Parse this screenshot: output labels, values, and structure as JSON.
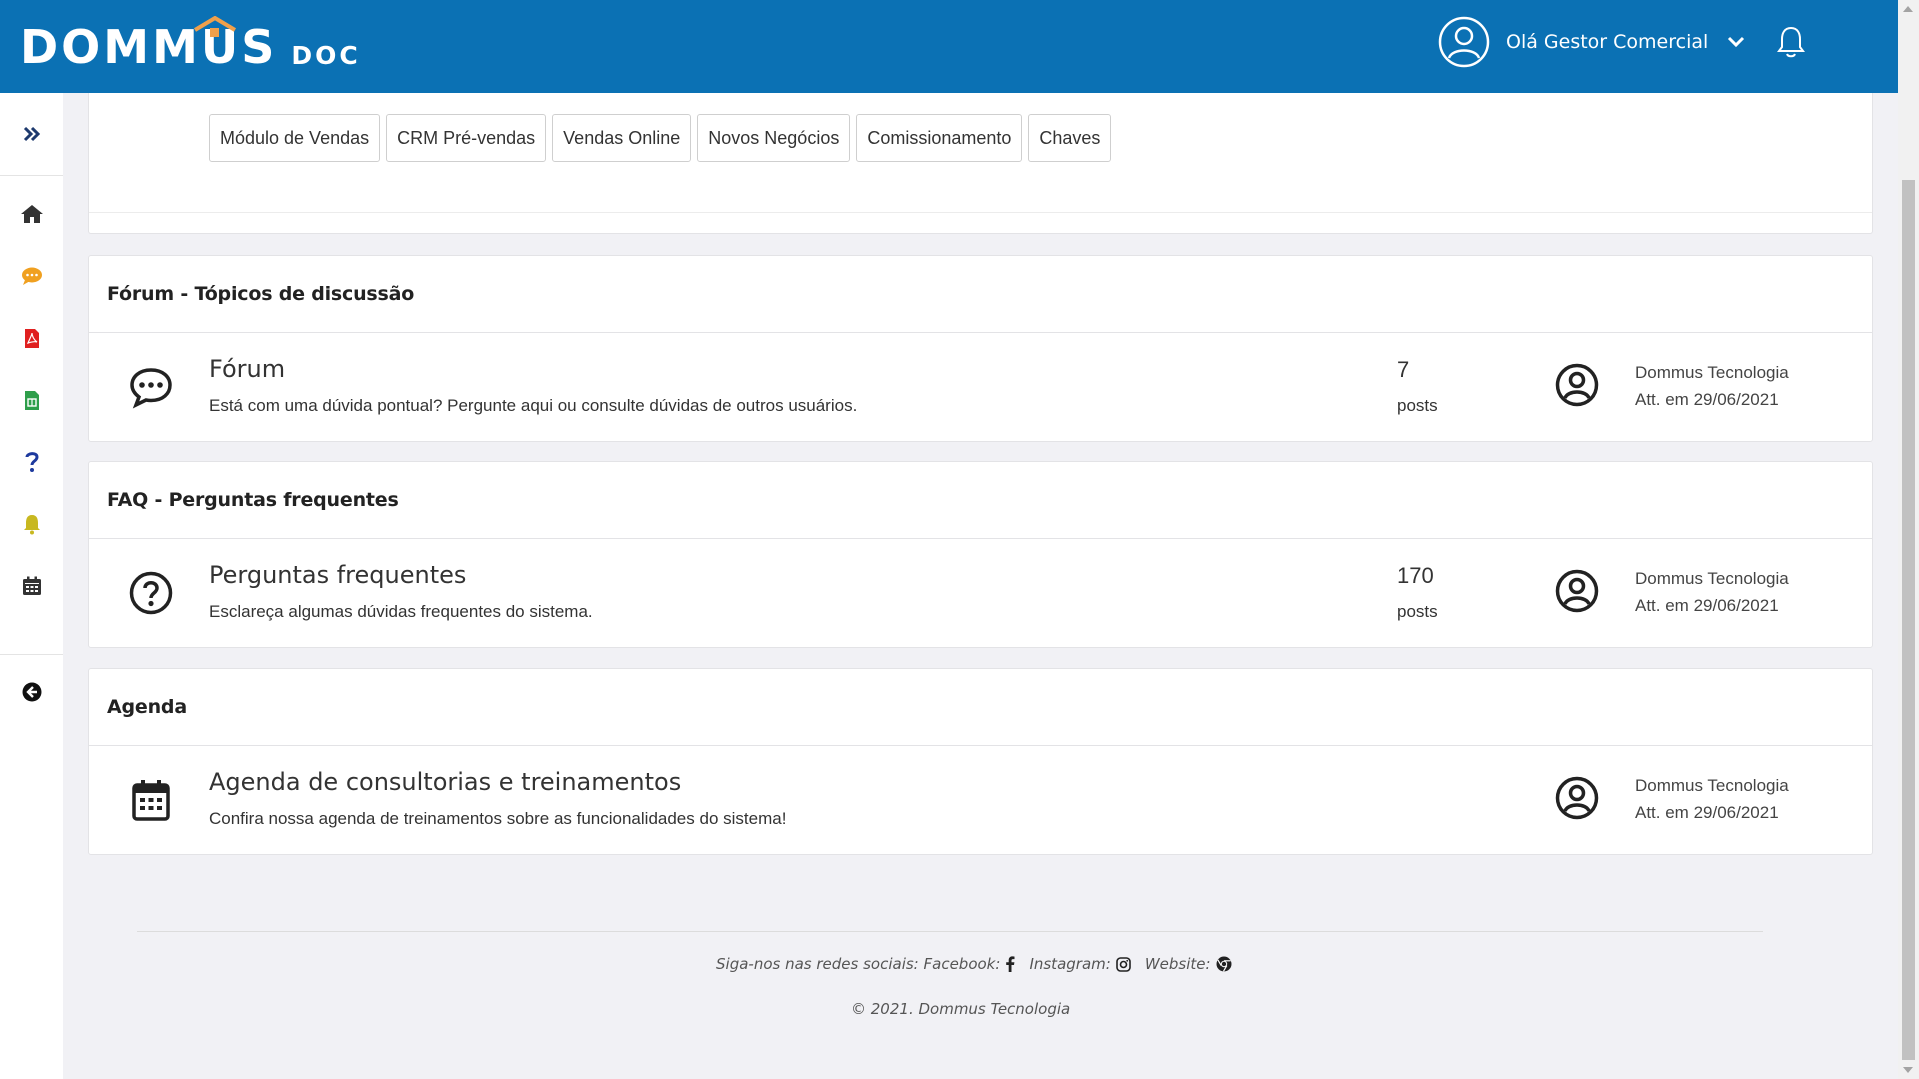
{
  "header": {
    "logo_main": "DOMMUS",
    "logo_sub": "DOC",
    "user_greeting": "Olá Gestor Comercial",
    "brand_color": "#0b71b4",
    "roof_color": "#f0a04b"
  },
  "sidebar": {
    "items": [
      {
        "icon": "double-chevron-right-icon",
        "color": "#1e3a6e"
      },
      {
        "icon": "home-icon",
        "color": "#333333"
      },
      {
        "icon": "chat-bubble-icon",
        "color": "#f0a020"
      },
      {
        "icon": "pdf-file-icon",
        "color": "#e02020"
      },
      {
        "icon": "spreadsheet-file-icon",
        "color": "#2e9e4a"
      },
      {
        "icon": "question-icon",
        "color": "#1e3a9e"
      },
      {
        "icon": "bell-icon",
        "color": "#c8b820"
      },
      {
        "icon": "calendar-icon",
        "color": "#333333"
      },
      {
        "icon": "arrow-left-circle-icon",
        "color": "#111111"
      }
    ]
  },
  "modules": [
    "Módulo de Vendas",
    "CRM Pré-vendas",
    "Vendas Online",
    "Novos Negócios",
    "Comissionamento",
    "Chaves"
  ],
  "sections": [
    {
      "heading": "Fórum - Tópicos de discussão",
      "title": "Fórum",
      "description": "Está com uma dúvida pontual? Pergunte aqui ou consulte dúvidas de outros usuários.",
      "count": "7",
      "count_label": "posts",
      "author": "Dommus Tecnologia",
      "updated": "Att. em 29/06/2021"
    },
    {
      "heading": "FAQ - Perguntas frequentes",
      "title": "Perguntas frequentes",
      "description": "Esclareça algumas dúvidas frequentes do sistema.",
      "count": "170",
      "count_label": "posts",
      "author": "Dommus Tecnologia",
      "updated": "Att. em 29/06/2021"
    },
    {
      "heading": "Agenda",
      "title": "Agenda de consultorias e treinamentos",
      "description": "Confira nossa agenda de treinamentos sobre as funcionalidades do sistema!",
      "author": "Dommus Tecnologia",
      "updated": "Att. em 29/06/2021"
    }
  ],
  "footer": {
    "follow_text": "Siga-nos nas redes sociais:",
    "facebook": "Facebook:",
    "instagram": "Instagram:",
    "website": "Website:",
    "copyright": "© 2021. Dommus Tecnologia"
  }
}
